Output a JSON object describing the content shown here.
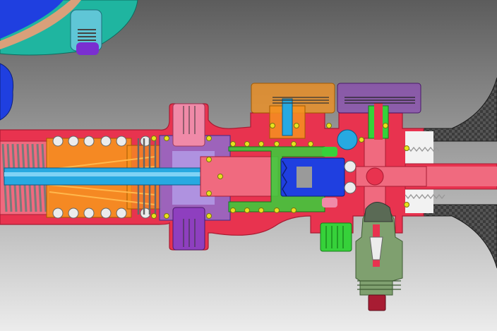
{
  "colors": {
    "background_top": "#5c5c5c",
    "background_bottom": "#ececec",
    "body": "#e8334f",
    "body_dark": "#a81c33",
    "bore": "#f06a7f",
    "spring": "#9a9a9a",
    "ball": "#ececec",
    "orange_part": "#f6921e",
    "stem": "#27a9e1",
    "violet_part": "#8a6fd6",
    "purple_part": "#8e3fbf",
    "pink_part": "#f08aa8",
    "green_part": "#36d13a",
    "blue_part": "#1f3fe0",
    "seal": "#e8e21e",
    "gray_green_part": "#7fa06f",
    "carbon": "#3b3b3b",
    "teal_part": "#1fb5a0",
    "thread": "#f2f2f2"
  },
  "icons": {
    "spring": "coil-spring-icon",
    "ball_bearing": "ball-icon",
    "o_ring": "o-ring-icon",
    "thread": "thread-icon"
  }
}
